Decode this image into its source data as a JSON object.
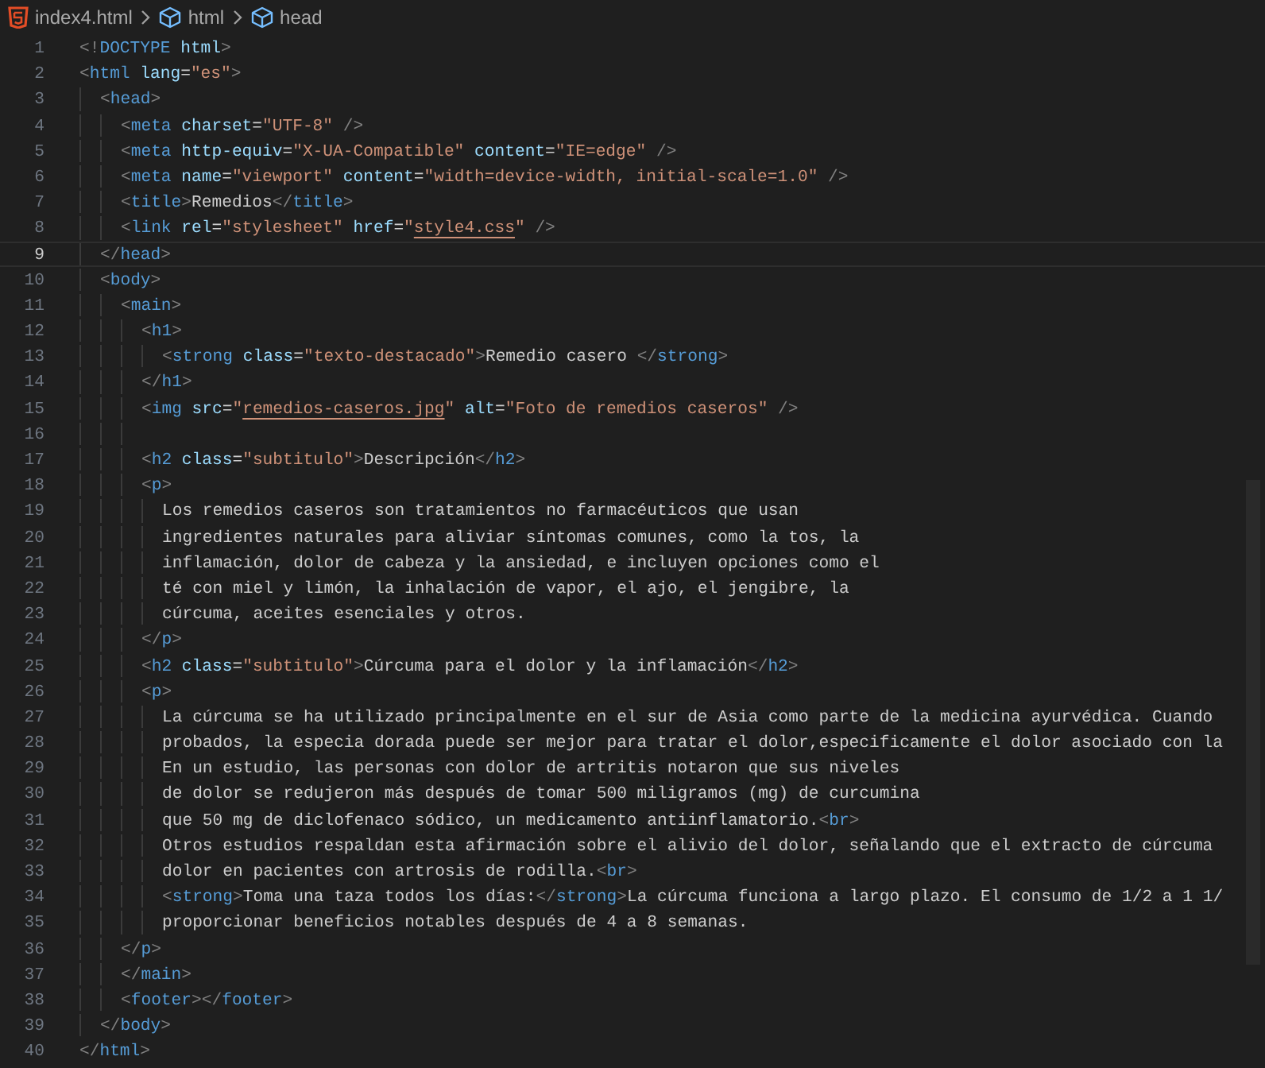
{
  "breadcrumb": [
    {
      "kind": "file",
      "label": "index4.html"
    },
    {
      "kind": "element",
      "label": "html"
    },
    {
      "kind": "element",
      "label": "head"
    }
  ],
  "lines": [
    {
      "number": "1",
      "active": false,
      "tokens": [
        {
          "kind": "punct",
          "text": "<!"
        },
        {
          "kind": "tag",
          "text": "DOCTYPE"
        },
        {
          "kind": "attr",
          "text": " html"
        },
        {
          "kind": "punct",
          "text": ">"
        }
      ]
    },
    {
      "number": "2",
      "active": false,
      "tokens": [
        {
          "kind": "punct",
          "text": "<"
        },
        {
          "kind": "tag",
          "text": "html"
        },
        {
          "kind": "attr",
          "text": " lang"
        },
        {
          "kind": "text",
          "text": "="
        },
        {
          "kind": "string",
          "text": "\"es\""
        },
        {
          "kind": "punct",
          "text": ">"
        }
      ],
      "children": [
        {
          "number": "3",
          "active": false,
          "tokens": [
            {
              "kind": "punct",
              "text": "<"
            },
            {
              "kind": "tag",
              "text": "head"
            },
            {
              "kind": "punct",
              "text": ">"
            }
          ],
          "children": [
            {
              "number": "4",
              "active": false,
              "tokens": [
                {
                  "kind": "punct",
                  "text": "<"
                },
                {
                  "kind": "tag",
                  "text": "meta"
                },
                {
                  "kind": "attr",
                  "text": " charset"
                },
                {
                  "kind": "text",
                  "text": "="
                },
                {
                  "kind": "string",
                  "text": "\"UTF-8\""
                },
                {
                  "kind": "punct",
                  "text": " />"
                }
              ]
            },
            {
              "number": "5",
              "active": false,
              "tokens": [
                {
                  "kind": "punct",
                  "text": "<"
                },
                {
                  "kind": "tag",
                  "text": "meta"
                },
                {
                  "kind": "attr",
                  "text": " http-equiv"
                },
                {
                  "kind": "text",
                  "text": "="
                },
                {
                  "kind": "string",
                  "text": "\"X-UA-Compatible\""
                },
                {
                  "kind": "attr",
                  "text": " content"
                },
                {
                  "kind": "text",
                  "text": "="
                },
                {
                  "kind": "string",
                  "text": "\"IE=edge\""
                },
                {
                  "kind": "punct",
                  "text": " />"
                }
              ]
            },
            {
              "number": "6",
              "active": false,
              "tokens": [
                {
                  "kind": "punct",
                  "text": "<"
                },
                {
                  "kind": "tag",
                  "text": "meta"
                },
                {
                  "kind": "attr",
                  "text": " name"
                },
                {
                  "kind": "text",
                  "text": "="
                },
                {
                  "kind": "string",
                  "text": "\"viewport\""
                },
                {
                  "kind": "attr",
                  "text": " content"
                },
                {
                  "kind": "text",
                  "text": "="
                },
                {
                  "kind": "string",
                  "text": "\"width=device-width, initial-scale=1.0\""
                },
                {
                  "kind": "punct",
                  "text": " />"
                }
              ]
            },
            {
              "number": "7",
              "active": false,
              "tokens": [
                {
                  "kind": "punct",
                  "text": "<"
                },
                {
                  "kind": "tag",
                  "text": "title"
                },
                {
                  "kind": "punct",
                  "text": ">"
                },
                {
                  "kind": "text",
                  "text": "Remedios"
                },
                {
                  "kind": "punct",
                  "text": "</"
                },
                {
                  "kind": "tag",
                  "text": "title"
                },
                {
                  "kind": "punct",
                  "text": ">"
                }
              ]
            },
            {
              "number": "8",
              "active": false,
              "tokens": [
                {
                  "kind": "punct",
                  "text": "<"
                },
                {
                  "kind": "tag",
                  "text": "link"
                },
                {
                  "kind": "attr",
                  "text": " rel"
                },
                {
                  "kind": "text",
                  "text": "="
                },
                {
                  "kind": "string",
                  "text": "\"stylesheet\""
                },
                {
                  "kind": "attr",
                  "text": " href"
                },
                {
                  "kind": "text",
                  "text": "="
                },
                {
                  "kind": "string",
                  "text": "\""
                },
                {
                  "kind": "link",
                  "text": "style4.css"
                },
                {
                  "kind": "string",
                  "text": "\""
                },
                {
                  "kind": "punct",
                  "text": " />"
                }
              ]
            }
          ]
        },
        {
          "number": "9",
          "active": true,
          "tokens": [
            {
              "kind": "punct",
              "text": "</"
            },
            {
              "kind": "tag",
              "text": "head"
            },
            {
              "kind": "punct",
              "text": ">"
            }
          ]
        },
        {
          "number": "10",
          "active": false,
          "tokens": [
            {
              "kind": "punct",
              "text": "<"
            },
            {
              "kind": "tag",
              "text": "body"
            },
            {
              "kind": "punct",
              "text": ">"
            }
          ],
          "children": [
            {
              "number": "11",
              "active": false,
              "tokens": [
                {
                  "kind": "punct",
                  "text": "<"
                },
                {
                  "kind": "tag",
                  "text": "main"
                },
                {
                  "kind": "punct",
                  "text": ">"
                }
              ],
              "children": [
                {
                  "number": "12",
                  "active": false,
                  "tokens": [
                    {
                      "kind": "punct",
                      "text": "<"
                    },
                    {
                      "kind": "tag",
                      "text": "h1"
                    },
                    {
                      "kind": "punct",
                      "text": ">"
                    }
                  ],
                  "children": [
                    {
                      "number": "13",
                      "active": false,
                      "tokens": [
                        {
                          "kind": "punct",
                          "text": "<"
                        },
                        {
                          "kind": "tag",
                          "text": "strong"
                        },
                        {
                          "kind": "attr",
                          "text": " class"
                        },
                        {
                          "kind": "text",
                          "text": "="
                        },
                        {
                          "kind": "string",
                          "text": "\"texto-destacado\""
                        },
                        {
                          "kind": "punct",
                          "text": ">"
                        },
                        {
                          "kind": "text",
                          "text": "Remedio casero "
                        },
                        {
                          "kind": "punct",
                          "text": "</"
                        },
                        {
                          "kind": "tag",
                          "text": "strong"
                        },
                        {
                          "kind": "punct",
                          "text": ">"
                        }
                      ]
                    }
                  ]
                },
                {
                  "number": "14",
                  "active": false,
                  "tokens": [
                    {
                      "kind": "punct",
                      "text": "</"
                    },
                    {
                      "kind": "tag",
                      "text": "h1"
                    },
                    {
                      "kind": "punct",
                      "text": ">"
                    }
                  ]
                },
                {
                  "number": "15",
                  "active": false,
                  "tokens": [
                    {
                      "kind": "punct",
                      "text": "<"
                    },
                    {
                      "kind": "tag",
                      "text": "img"
                    },
                    {
                      "kind": "attr",
                      "text": " src"
                    },
                    {
                      "kind": "text",
                      "text": "="
                    },
                    {
                      "kind": "string",
                      "text": "\""
                    },
                    {
                      "kind": "link",
                      "text": "remedios-caseros.jpg"
                    },
                    {
                      "kind": "string",
                      "text": "\""
                    },
                    {
                      "kind": "attr",
                      "text": " alt"
                    },
                    {
                      "kind": "text",
                      "text": "="
                    },
                    {
                      "kind": "string",
                      "text": "\"Foto de remedios caseros\""
                    },
                    {
                      "kind": "punct",
                      "text": " />"
                    }
                  ]
                },
                {
                  "number": "16",
                  "active": false
                },
                {
                  "number": "17",
                  "active": false,
                  "tokens": [
                    {
                      "kind": "punct",
                      "text": "<"
                    },
                    {
                      "kind": "tag",
                      "text": "h2"
                    },
                    {
                      "kind": "attr",
                      "text": " class"
                    },
                    {
                      "kind": "text",
                      "text": "="
                    },
                    {
                      "kind": "string",
                      "text": "\"subtitulo\""
                    },
                    {
                      "kind": "punct",
                      "text": ">"
                    },
                    {
                      "kind": "text",
                      "text": "Descripción"
                    },
                    {
                      "kind": "punct",
                      "text": "</"
                    },
                    {
                      "kind": "tag",
                      "text": "h2"
                    },
                    {
                      "kind": "punct",
                      "text": ">"
                    }
                  ]
                },
                {
                  "number": "18",
                  "active": false,
                  "tokens": [
                    {
                      "kind": "punct",
                      "text": "<"
                    },
                    {
                      "kind": "tag",
                      "text": "p"
                    },
                    {
                      "kind": "punct",
                      "text": ">"
                    }
                  ],
                  "children": [
                    {
                      "number": "19",
                      "active": false,
                      "tokens": [
                        {
                          "kind": "text",
                          "text": "Los remedios caseros son tratamientos no farmacéuticos que usan"
                        }
                      ]
                    },
                    {
                      "number": "20",
                      "active": false,
                      "tokens": [
                        {
                          "kind": "text",
                          "text": "ingredientes naturales para aliviar síntomas comunes, como la tos, la"
                        }
                      ]
                    },
                    {
                      "number": "21",
                      "active": false,
                      "tokens": [
                        {
                          "kind": "text",
                          "text": "inflamación, dolor de cabeza y la ansiedad, e incluyen opciones como el"
                        }
                      ]
                    },
                    {
                      "number": "22",
                      "active": false,
                      "tokens": [
                        {
                          "kind": "text",
                          "text": "té con miel y limón, la inhalación de vapor, el ajo, el jengibre, la"
                        }
                      ]
                    },
                    {
                      "number": "23",
                      "active": false,
                      "tokens": [
                        {
                          "kind": "text",
                          "text": "cúrcuma, aceites esenciales y otros."
                        }
                      ]
                    }
                  ]
                },
                {
                  "number": "24",
                  "active": false,
                  "tokens": [
                    {
                      "kind": "punct",
                      "text": "</"
                    },
                    {
                      "kind": "tag",
                      "text": "p"
                    },
                    {
                      "kind": "punct",
                      "text": ">"
                    }
                  ]
                },
                {
                  "number": "25",
                  "active": false,
                  "tokens": [
                    {
                      "kind": "punct",
                      "text": "<"
                    },
                    {
                      "kind": "tag",
                      "text": "h2"
                    },
                    {
                      "kind": "attr",
                      "text": " class"
                    },
                    {
                      "kind": "text",
                      "text": "="
                    },
                    {
                      "kind": "string",
                      "text": "\"subtitulo\""
                    },
                    {
                      "kind": "punct",
                      "text": ">"
                    },
                    {
                      "kind": "text",
                      "text": "Cúrcuma para el dolor y la inflamación"
                    },
                    {
                      "kind": "punct",
                      "text": "</"
                    },
                    {
                      "kind": "tag",
                      "text": "h2"
                    },
                    {
                      "kind": "punct",
                      "text": ">"
                    }
                  ]
                },
                {
                  "number": "26",
                  "active": false,
                  "tokens": [
                    {
                      "kind": "punct",
                      "text": "<"
                    },
                    {
                      "kind": "tag",
                      "text": "p"
                    },
                    {
                      "kind": "punct",
                      "text": ">"
                    }
                  ],
                  "children": [
                    {
                      "number": "27",
                      "active": false,
                      "tokens": [
                        {
                          "kind": "text",
                          "text": "La cúrcuma se ha utilizado principalmente en el sur de Asia como parte de la medicina ayurvédica. Cuando"
                        }
                      ]
                    },
                    {
                      "number": "28",
                      "active": false,
                      "tokens": [
                        {
                          "kind": "text",
                          "text": "probados, la especia dorada puede ser mejor para tratar el dolor,especificamente el dolor asociado con la"
                        }
                      ]
                    },
                    {
                      "number": "29",
                      "active": false,
                      "tokens": [
                        {
                          "kind": "text",
                          "text": "En un estudio, las personas con dolor de artritis notaron que sus niveles"
                        }
                      ]
                    },
                    {
                      "number": "30",
                      "active": false,
                      "tokens": [
                        {
                          "kind": "text",
                          "text": "de dolor se redujeron más después de tomar 500 miligramos (mg) de curcumina"
                        }
                      ]
                    },
                    {
                      "number": "31",
                      "active": false,
                      "tokens": [
                        {
                          "kind": "text",
                          "text": "que 50 mg de diclofenaco sódico, un medicamento antiinflamatorio."
                        },
                        {
                          "kind": "punct",
                          "text": "<"
                        },
                        {
                          "kind": "tag",
                          "text": "br"
                        },
                        {
                          "kind": "punct",
                          "text": ">"
                        }
                      ]
                    },
                    {
                      "number": "32",
                      "active": false,
                      "tokens": [
                        {
                          "kind": "text",
                          "text": "Otros estudios respaldan esta afirmación sobre el alivio del dolor, señalando que el extracto de cúrcuma"
                        }
                      ]
                    },
                    {
                      "number": "33",
                      "active": false,
                      "tokens": [
                        {
                          "kind": "text",
                          "text": "dolor en pacientes con artrosis de rodilla."
                        },
                        {
                          "kind": "punct",
                          "text": "<"
                        },
                        {
                          "kind": "tag",
                          "text": "br"
                        },
                        {
                          "kind": "punct",
                          "text": ">"
                        }
                      ]
                    },
                    {
                      "number": "34",
                      "active": false,
                      "tokens": [
                        {
                          "kind": "punct",
                          "text": "<"
                        },
                        {
                          "kind": "tag",
                          "text": "strong"
                        },
                        {
                          "kind": "punct",
                          "text": ">"
                        },
                        {
                          "kind": "text",
                          "text": "Toma una taza todos los días:"
                        },
                        {
                          "kind": "punct",
                          "text": "</"
                        },
                        {
                          "kind": "tag",
                          "text": "strong"
                        },
                        {
                          "kind": "punct",
                          "text": ">"
                        },
                        {
                          "kind": "text",
                          "text": "La cúrcuma funciona a largo plazo. El consumo de 1/2 a 1 1/"
                        }
                      ]
                    },
                    {
                      "number": "35",
                      "active": false,
                      "tokens": [
                        {
                          "kind": "text",
                          "text": "proporcionar beneficios notables después de 4 a 8 semanas."
                        }
                      ]
                    }
                  ]
                }
              ]
            },
            {
              "number": "36",
              "active": false,
              "tokens": [
                {
                  "kind": "punct",
                  "text": "</"
                },
                {
                  "kind": "tag",
                  "text": "p"
                },
                {
                  "kind": "punct",
                  "text": ">"
                }
              ]
            },
            {
              "number": "37",
              "active": false,
              "tokens": [
                {
                  "kind": "punct",
                  "text": "</"
                },
                {
                  "kind": "tag",
                  "text": "main"
                },
                {
                  "kind": "punct",
                  "text": ">"
                }
              ]
            },
            {
              "number": "38",
              "active": false,
              "tokens": [
                {
                  "kind": "punct",
                  "text": "<"
                },
                {
                  "kind": "tag",
                  "text": "footer"
                },
                {
                  "kind": "punct",
                  "text": "></"
                },
                {
                  "kind": "tag",
                  "text": "footer"
                },
                {
                  "kind": "punct",
                  "text": ">"
                }
              ]
            }
          ]
        },
        {
          "number": "39",
          "active": false,
          "tokens": [
            {
              "kind": "punct",
              "text": "</"
            },
            {
              "kind": "tag",
              "text": "body"
            },
            {
              "kind": "punct",
              "text": ">"
            }
          ]
        }
      ]
    },
    {
      "number": "40",
      "active": false,
      "tokens": [
        {
          "kind": "punct",
          "text": "</"
        },
        {
          "kind": "tag",
          "text": "html"
        },
        {
          "kind": "punct",
          "text": ">"
        }
      ]
    }
  ]
}
